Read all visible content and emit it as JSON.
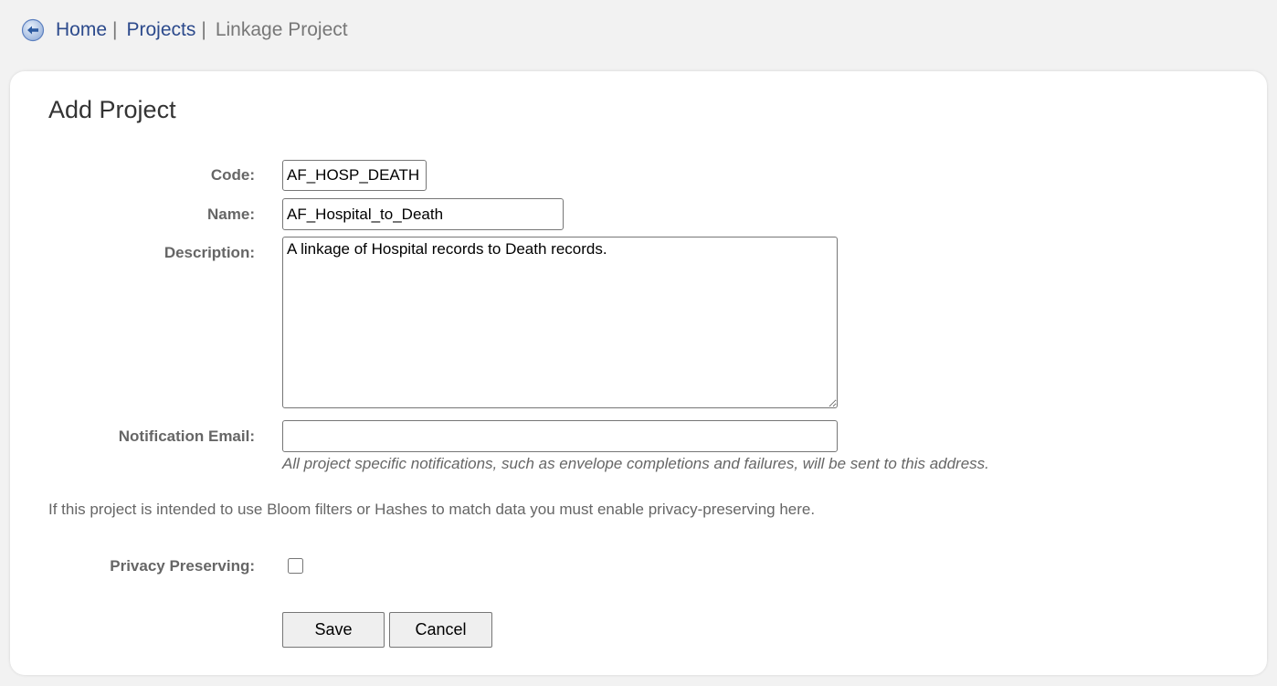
{
  "breadcrumb": {
    "home": "Home",
    "projects": "Projects",
    "separator": "|",
    "current": "Linkage Project",
    "back_icon": "back-arrow-circle-icon",
    "link_color": "#2c4a8c"
  },
  "form": {
    "title": "Add Project",
    "code": {
      "label": "Code:",
      "value": "AF_HOSP_DEATH"
    },
    "name": {
      "label": "Name:",
      "value": "AF_Hospital_to_Death"
    },
    "description": {
      "label": "Description:",
      "value": "A linkage of Hospital records to Death records."
    },
    "notification_email": {
      "label": "Notification Email:",
      "value": "",
      "help": "All project specific notifications, such as envelope completions and failures, will be sent to this address."
    },
    "privacy_note": "If this project is intended to use Bloom filters or Hashes to match data you must enable privacy-preserving here.",
    "privacy_preserving": {
      "label": "Privacy Preserving:",
      "checked": false
    },
    "buttons": {
      "save": "Save",
      "cancel": "Cancel"
    }
  }
}
